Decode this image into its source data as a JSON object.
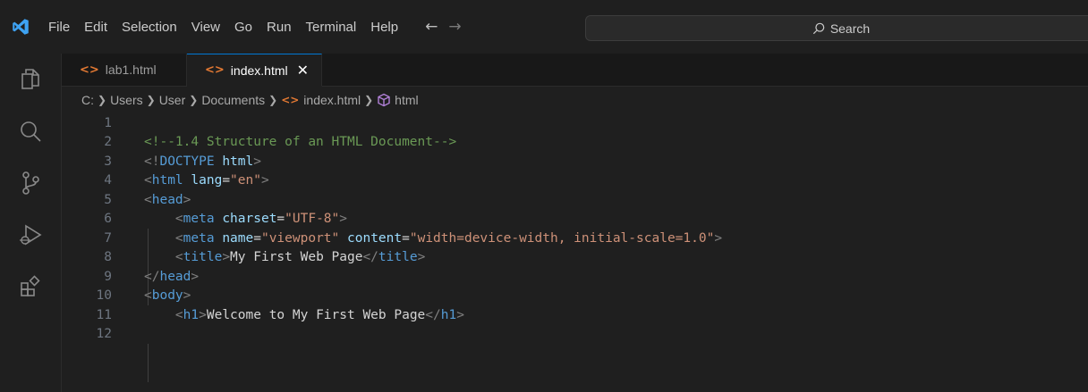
{
  "menu": [
    "File",
    "Edit",
    "Selection",
    "View",
    "Go",
    "Run",
    "Terminal",
    "Help"
  ],
  "search": {
    "label": "Search"
  },
  "tabs": [
    {
      "name": "lab1.html",
      "active": false
    },
    {
      "name": "index.html",
      "active": true
    }
  ],
  "breadcrumbs": [
    "C:",
    "Users",
    "User",
    "Documents",
    "index.html",
    "html"
  ],
  "code": [
    {
      "n": "1",
      "tokens": []
    },
    {
      "n": "2",
      "tokens": [
        [
          "comment",
          "<!--1.4 Structure of an HTML Document-->"
        ]
      ]
    },
    {
      "n": "3",
      "tokens": [
        [
          "punct",
          "<!"
        ],
        [
          "tag",
          "DOCTYPE"
        ],
        [
          "text",
          " "
        ],
        [
          "attr",
          "html"
        ],
        [
          "punct",
          ">"
        ]
      ]
    },
    {
      "n": "4",
      "tokens": [
        [
          "punct",
          "<"
        ],
        [
          "tag",
          "html"
        ],
        [
          "text",
          " "
        ],
        [
          "attr",
          "lang"
        ],
        [
          "text",
          "="
        ],
        [
          "str",
          "\"en\""
        ],
        [
          "punct",
          ">"
        ]
      ]
    },
    {
      "n": "5",
      "tokens": [
        [
          "punct",
          "<"
        ],
        [
          "tag",
          "head"
        ],
        [
          "punct",
          ">"
        ]
      ]
    },
    {
      "n": "6",
      "tokens": [
        [
          "text",
          "    "
        ],
        [
          "punct",
          "<"
        ],
        [
          "tag",
          "meta"
        ],
        [
          "text",
          " "
        ],
        [
          "attr",
          "charset"
        ],
        [
          "text",
          "="
        ],
        [
          "str",
          "\"UTF-8\""
        ],
        [
          "punct",
          ">"
        ]
      ]
    },
    {
      "n": "7",
      "tokens": [
        [
          "text",
          "    "
        ],
        [
          "punct",
          "<"
        ],
        [
          "tag",
          "meta"
        ],
        [
          "text",
          " "
        ],
        [
          "attr",
          "name"
        ],
        [
          "text",
          "="
        ],
        [
          "str",
          "\"viewport\""
        ],
        [
          "text",
          " "
        ],
        [
          "attr",
          "content"
        ],
        [
          "text",
          "="
        ],
        [
          "str",
          "\"width=device-width, initial-scale=1.0\""
        ],
        [
          "punct",
          ">"
        ]
      ]
    },
    {
      "n": "8",
      "tokens": [
        [
          "text",
          "    "
        ],
        [
          "punct",
          "<"
        ],
        [
          "tag",
          "title"
        ],
        [
          "punct",
          ">"
        ],
        [
          "text",
          "My First Web Page"
        ],
        [
          "punct",
          "</"
        ],
        [
          "tag",
          "title"
        ],
        [
          "punct",
          ">"
        ]
      ]
    },
    {
      "n": "9",
      "tokens": [
        [
          "punct",
          "</"
        ],
        [
          "tag",
          "head"
        ],
        [
          "punct",
          ">"
        ]
      ]
    },
    {
      "n": "10",
      "tokens": [
        [
          "punct",
          "<"
        ],
        [
          "tag",
          "body"
        ],
        [
          "punct",
          ">"
        ]
      ]
    },
    {
      "n": "11",
      "tokens": [
        [
          "text",
          "    "
        ],
        [
          "punct",
          "<"
        ],
        [
          "tag",
          "h1"
        ],
        [
          "punct",
          ">"
        ],
        [
          "text",
          "Welcome to My First Web Page"
        ],
        [
          "punct",
          "</"
        ],
        [
          "tag",
          "h1"
        ],
        [
          "punct",
          ">"
        ]
      ]
    },
    {
      "n": "12",
      "tokens": []
    }
  ],
  "colors": {
    "accent": "#0078d4",
    "file_icon": "#e37933",
    "logo": "#3ea2f2"
  }
}
